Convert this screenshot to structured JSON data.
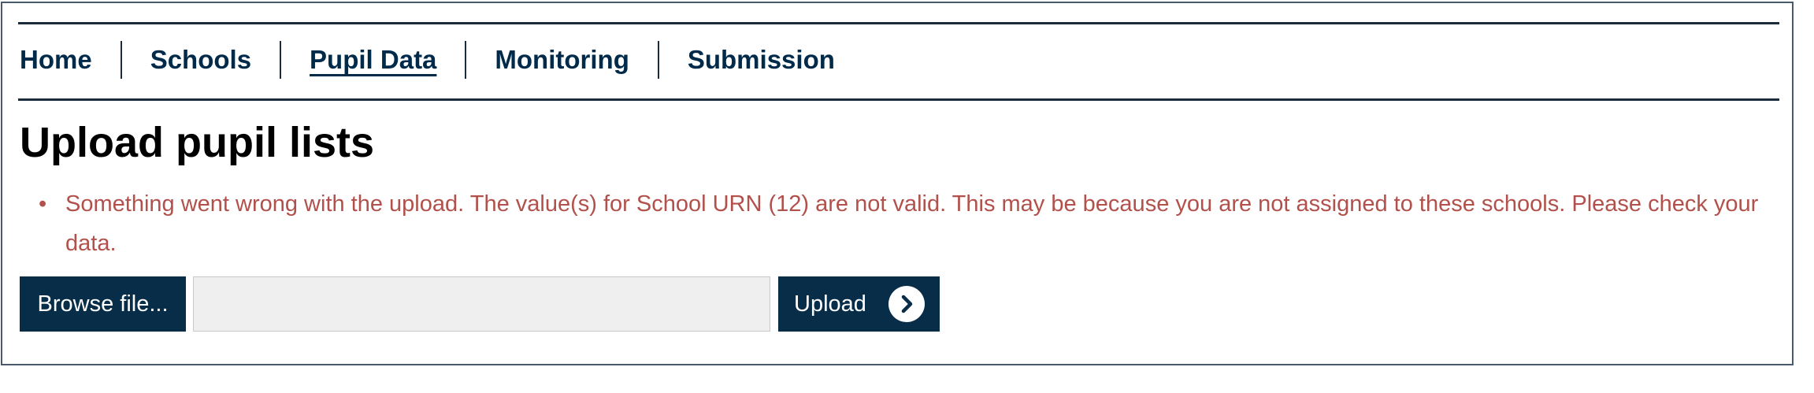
{
  "nav": {
    "items": [
      {
        "label": "Home",
        "active": false
      },
      {
        "label": "Schools",
        "active": false
      },
      {
        "label": "Pupil Data",
        "active": true
      },
      {
        "label": "Monitoring",
        "active": false
      },
      {
        "label": "Submission",
        "active": false
      }
    ]
  },
  "page": {
    "title": "Upload pupil lists"
  },
  "errors": {
    "bullet": "•",
    "message": "Something went wrong with the upload. The value(s) for School URN (12) are not valid. This may be because you are not assigned to these schools. Please check your data."
  },
  "upload": {
    "browse_label": "Browse file...",
    "file_value": "",
    "upload_label": "Upload",
    "upload_icon": "chevron-right-circle-icon"
  },
  "colors": {
    "navy": "#002a4a",
    "button_bg": "#072d48",
    "error_text": "#b2514b",
    "file_field_bg": "#efefef"
  }
}
